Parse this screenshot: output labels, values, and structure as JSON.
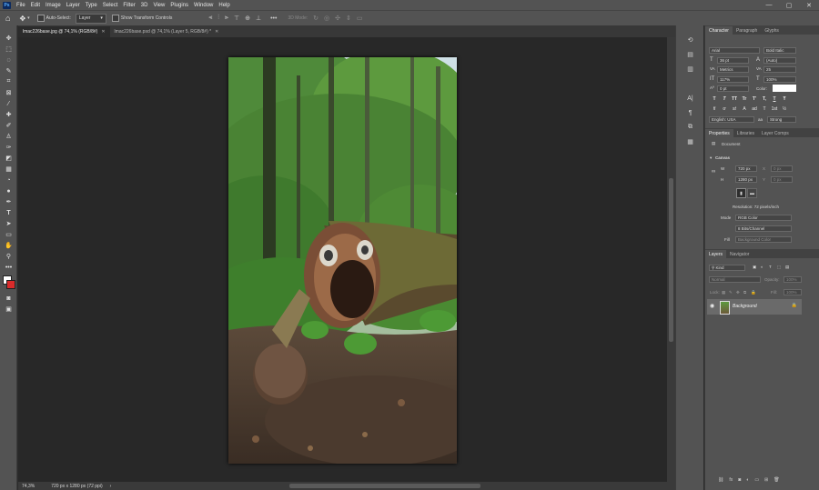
{
  "menubar": {
    "logo": "Ps",
    "items": [
      "File",
      "Edit",
      "Image",
      "Layer",
      "Type",
      "Select",
      "Filter",
      "3D",
      "View",
      "Plugins",
      "Window",
      "Help"
    ]
  },
  "window_controls": {
    "minimize": "—",
    "maximize": "▢",
    "close": "✕"
  },
  "options": {
    "auto_select_label": "Auto-Select:",
    "auto_select_value": "Layer",
    "show_transform_label": "Show Transform Controls",
    "mode_3d_label": "3D Mode:"
  },
  "tabs": [
    {
      "label": "lmac226base.jpg @ 74,1% (RGB/8#)",
      "close": "✕"
    },
    {
      "label": "lmac226base.psd @ 74,1% (Layer 5, RGB/8#) *",
      "close": "✕"
    }
  ],
  "status": {
    "zoom": "74,3%",
    "doc_info": "720 px x 1280 px (72 ppi)",
    "arrow": "›"
  },
  "character": {
    "tabs": [
      "Character",
      "Paragraph",
      "Glyphs"
    ],
    "font_family": "Arial",
    "font_style": "Bold Italic",
    "font_size": "36 pt",
    "leading": "(Auto)",
    "kerning": "Metrics",
    "tracking": "25",
    "vertical_scale": "117%",
    "horizontal_scale": "100%",
    "baseline_shift": "0 pt",
    "color_label": "Color:",
    "style_buttons": [
      "T",
      "T",
      "TT",
      "Tr",
      "T'",
      "T,",
      "T",
      "Ŧ"
    ],
    "opentype_buttons": [
      "fi",
      "ơ",
      "st",
      "A",
      "ad",
      "T",
      "1st",
      "½"
    ],
    "language": "English: USA",
    "antialias_icon": "aa",
    "antialias": "Strong"
  },
  "properties": {
    "tabs": [
      "Properties",
      "Libraries",
      "Layer Comps"
    ],
    "document_label": "Document",
    "section_label": "Canvas",
    "w_label": "W",
    "w_value": "720 px",
    "h_label": "H",
    "h_value": "1280 px",
    "x_label": "X",
    "x_value": "0 px",
    "y_label": "Y",
    "y_value": "0 px",
    "resolution": "Resolution: 72 pixels/inch",
    "mode_label": "Mode",
    "mode_value": "RGB Color",
    "depth_value": "8 Bits/Channel",
    "fill_label": "Fill",
    "fill_value": "Background Color"
  },
  "layers": {
    "tabs": [
      "Layers",
      "Navigator"
    ],
    "search": "Kind",
    "blend": "Normal",
    "opacity_label": "Opacity:",
    "opacity_value": "100%",
    "lock_label": "Lock:",
    "fill_label": "Fill:",
    "fill_value": "100%",
    "items": [
      {
        "name": "Background",
        "visible": true,
        "locked": true
      }
    ]
  },
  "colors": {
    "accent_red": "#d92b2b",
    "panel": "#535353",
    "canvas_bg": "#282828"
  }
}
